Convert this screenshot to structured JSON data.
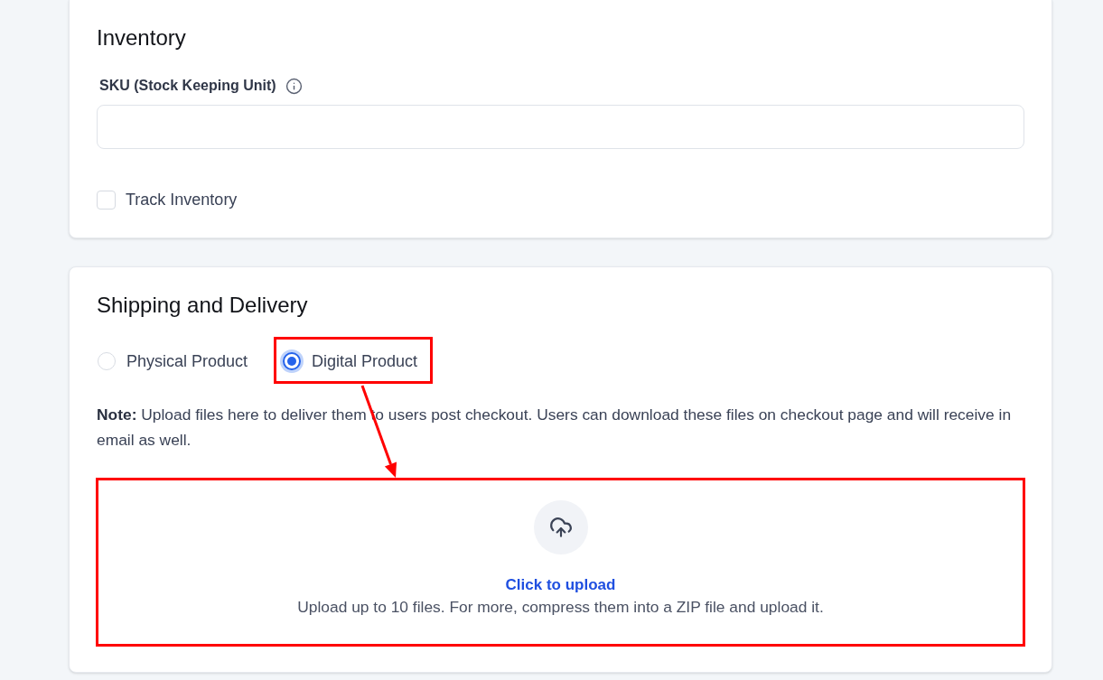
{
  "inventory": {
    "title": "Inventory",
    "sku": {
      "label": "SKU (Stock Keeping Unit)"
    },
    "track_inventory": {
      "label": "Track Inventory",
      "checked": false
    }
  },
  "shipping": {
    "title": "Shipping and Delivery",
    "options": [
      {
        "label": "Physical Product",
        "selected": false,
        "highlighted": false
      },
      {
        "label": "Digital Product",
        "selected": true,
        "highlighted": true
      }
    ],
    "annotation_arrow": true,
    "note": "**Note:** Upload files here to deliver them to users post checkout. Users can download these files on checkout page and will receive in email as well.",
    "upload": {
      "action": "Click to upload",
      "hint": "Upload up to 10 files. For more, compress them into a ZIP file and upload it.",
      "highlighted": true
    }
  }
}
